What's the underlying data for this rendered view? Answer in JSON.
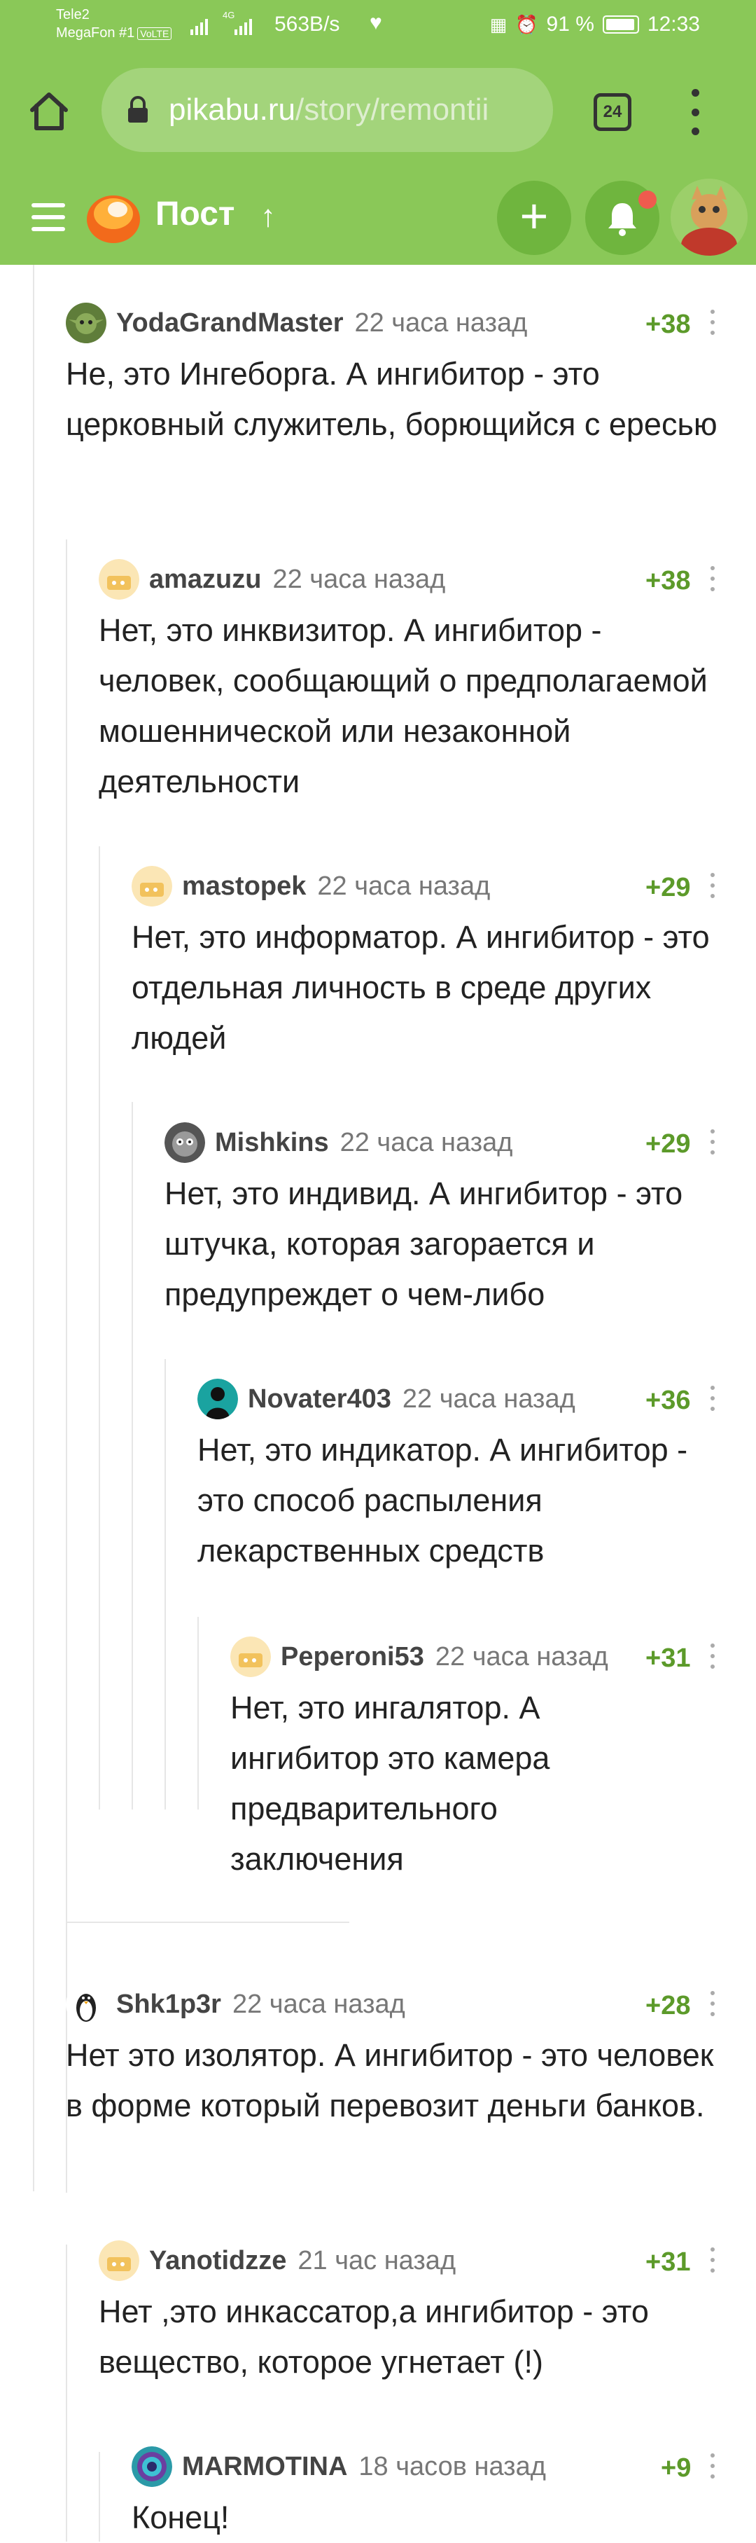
{
  "status_bar": {
    "carrier1": "Tele2",
    "carrier2": "MegaFon #1",
    "volte": "VoLTE",
    "network": "4G",
    "speed": "563B/s",
    "battery": "91 %",
    "time": "12:33"
  },
  "browser": {
    "url_host": "pikabu.ru",
    "url_path": "/story/remontii",
    "tab_count": "24"
  },
  "app_header": {
    "title": "Пост"
  },
  "comments": [
    {
      "author": "YodaGrandMaster",
      "time": "22 часа назад",
      "rating": "+38",
      "text": "Не, это Ингеборга. А ингибитор - это церковный служитель, борющийся с ересью"
    },
    {
      "author": "amazuzu",
      "time": "22 часа назад",
      "rating": "+38",
      "text": "Нет, это инквизитор. А ингибитор - человек, сообщающий о предполагаемой мошеннической или незаконной деятельности"
    },
    {
      "author": "mastopek",
      "time": "22 часа назад",
      "rating": "+29",
      "text": "Нет, это информатор. А ингибитор - это отдельная личность в среде других людей"
    },
    {
      "author": "Mishkins",
      "time": "22 часа назад",
      "rating": "+29",
      "text": "Нет, это индивид. А ингибитор - это штучка, которая загорается и предупреждет о чем-либо"
    },
    {
      "author": "Novater403",
      "time": "22 часа назад",
      "rating": "+36",
      "text": "Нет, это индикатор. А ингибитор - это способ распыления лекарственных средств"
    },
    {
      "author": "Peperoni53",
      "time": "22 часа назад",
      "rating": "+31",
      "text": "Нет, это ингалятор. А ингибитор это камера предварительного заключения"
    },
    {
      "author": "Shk1p3r",
      "time": "22 часа назад",
      "rating": "+28",
      "text": "Нет это изолятор. А ингибитор - это человек в форме который перевозит деньги банков."
    },
    {
      "author": "Yanotidzze",
      "time": "21 час назад",
      "rating": "+31",
      "text": "Нет ,это инкассатор,а ингибитор - это вещество, которое угнетает (!)"
    },
    {
      "author": "MARMOTINA",
      "time": "18 часов назад",
      "rating": "+9",
      "text": "Конец!"
    }
  ],
  "colors": {
    "brand_green": "#8ac858",
    "rating_green": "#5c9a2a",
    "notification_dot": "#ef5b4e"
  }
}
